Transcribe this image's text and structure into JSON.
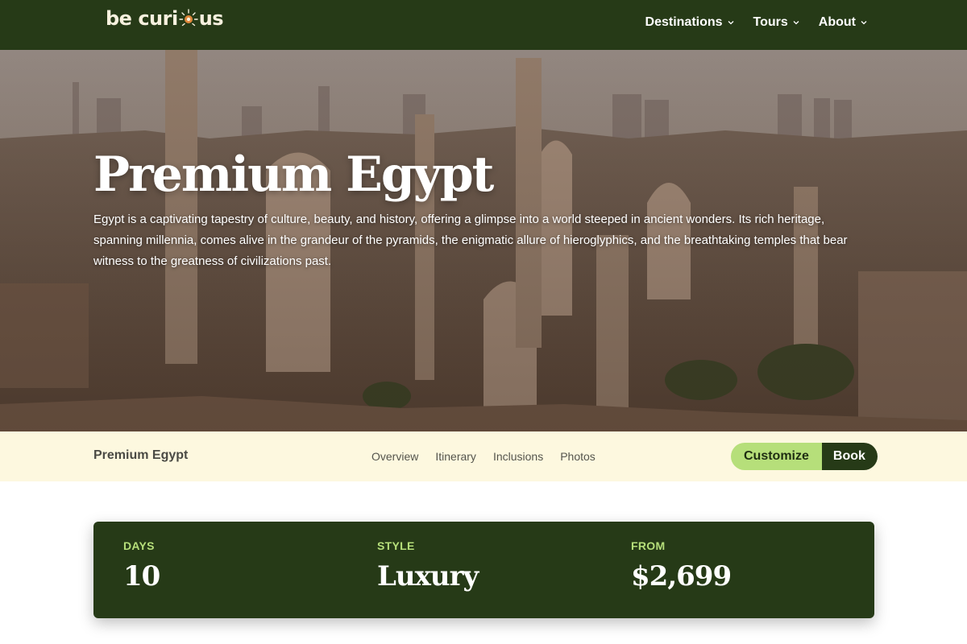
{
  "brand": {
    "name_part1": "be curi",
    "name_part2": "us"
  },
  "nav": {
    "items": [
      {
        "label": "Destinations"
      },
      {
        "label": "Tours"
      },
      {
        "label": "About"
      }
    ]
  },
  "hero": {
    "title": "Premium Egypt",
    "description": "Egypt is a captivating tapestry of culture, beauty, and history, offering a glimpse into a world steeped in ancient wonders. Its rich heritage, spanning millennia, comes alive in the grandeur of the pyramids, the enigmatic allure of hieroglyphics, and the breathtaking temples that bear witness to the greatness of civilizations past."
  },
  "subbar": {
    "title": "Premium Egypt",
    "links": [
      "Overview",
      "Itinerary",
      "Inclusions",
      "Photos"
    ],
    "customize_label": "Customize",
    "book_label": "Book"
  },
  "stats": [
    {
      "label": "DAYS",
      "value": "10"
    },
    {
      "label": "STYLE",
      "value": "Luxury"
    },
    {
      "label": "FROM",
      "value": "$2,699"
    }
  ],
  "colors": {
    "header_bg": "#263a17",
    "accent_green": "#b6df7a",
    "subbar_bg": "#fdf8df",
    "logo_sun": "#e0873a"
  }
}
